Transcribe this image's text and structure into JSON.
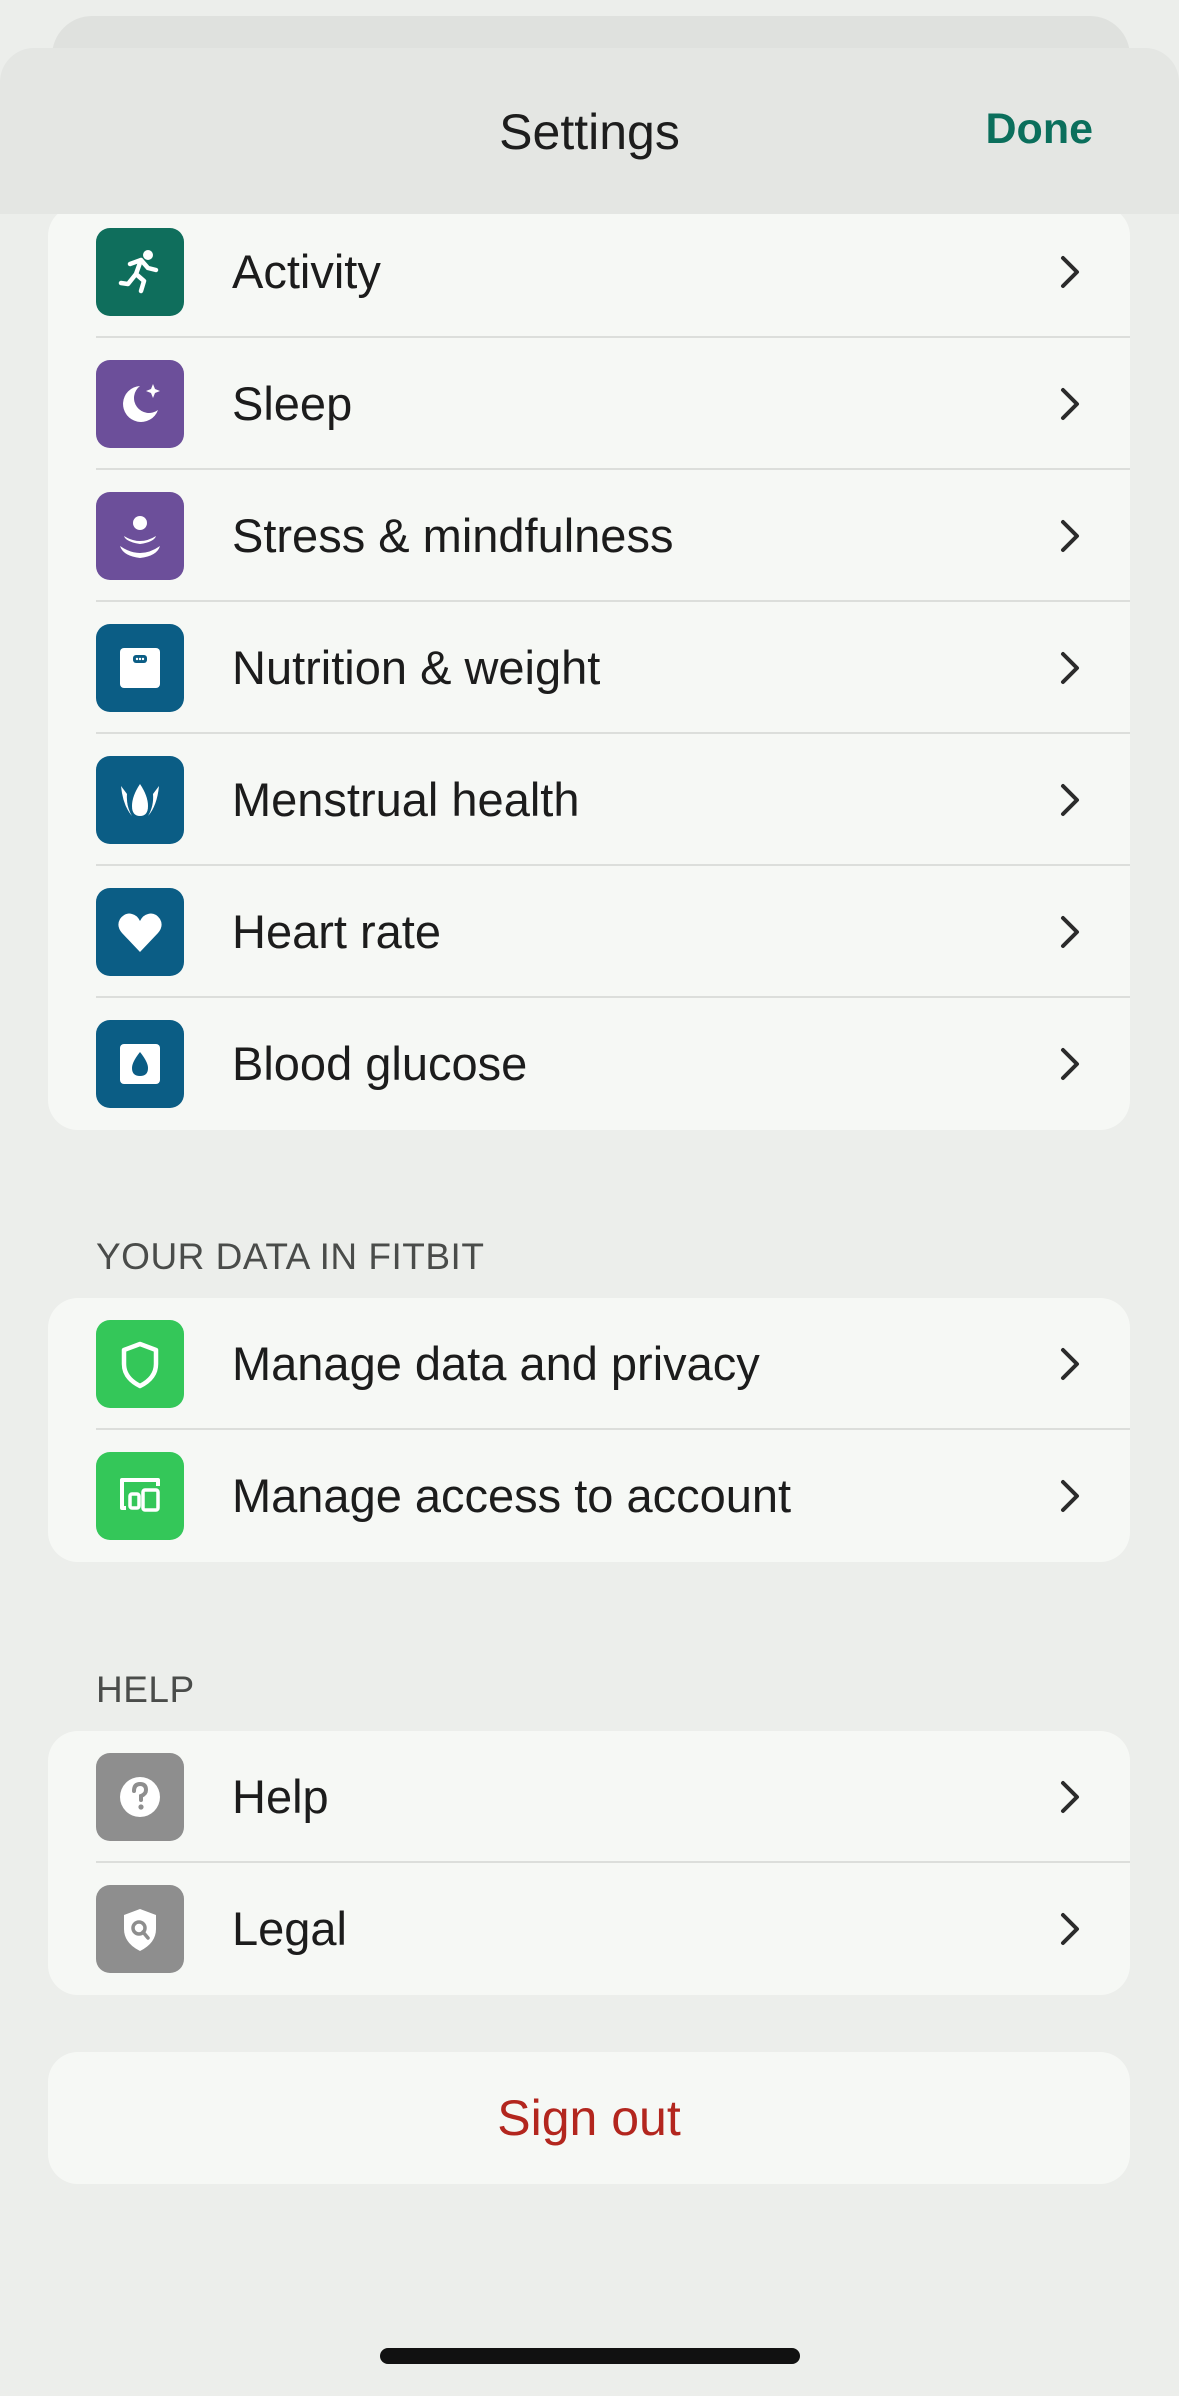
{
  "nav": {
    "title": "Settings",
    "done_label": "Done"
  },
  "health_group": {
    "items": [
      {
        "label": "Activity",
        "icon": "running-figure-icon",
        "color": "#0f6e5c"
      },
      {
        "label": "Sleep",
        "icon": "moon-star-icon",
        "color": "#6c4f9a"
      },
      {
        "label": "Stress & mindfulness",
        "icon": "meditation-icon",
        "color": "#6c4f9a"
      },
      {
        "label": "Nutrition & weight",
        "icon": "scale-icon",
        "color": "#0b5d85"
      },
      {
        "label": "Menstrual health",
        "icon": "lotus-icon",
        "color": "#0b5d85"
      },
      {
        "label": "Heart rate",
        "icon": "heart-icon",
        "color": "#0b5d85"
      },
      {
        "label": "Blood glucose",
        "icon": "blood-drop-icon",
        "color": "#0b5d85"
      }
    ]
  },
  "data_section": {
    "header": "YOUR DATA IN FITBIT",
    "items": [
      {
        "label": "Manage data and privacy",
        "icon": "shield-icon",
        "color": "#34c759"
      },
      {
        "label": "Manage access to account",
        "icon": "devices-icon",
        "color": "#34c759"
      }
    ]
  },
  "help_section": {
    "header": "HELP",
    "items": [
      {
        "label": "Help",
        "icon": "question-icon",
        "color": "#8e8e8e"
      },
      {
        "label": "Legal",
        "icon": "shield-search-icon",
        "color": "#8e8e8e"
      }
    ]
  },
  "signout": {
    "label": "Sign out",
    "color": "#b3261e"
  },
  "chevron_icon": "chevron-right-icon"
}
